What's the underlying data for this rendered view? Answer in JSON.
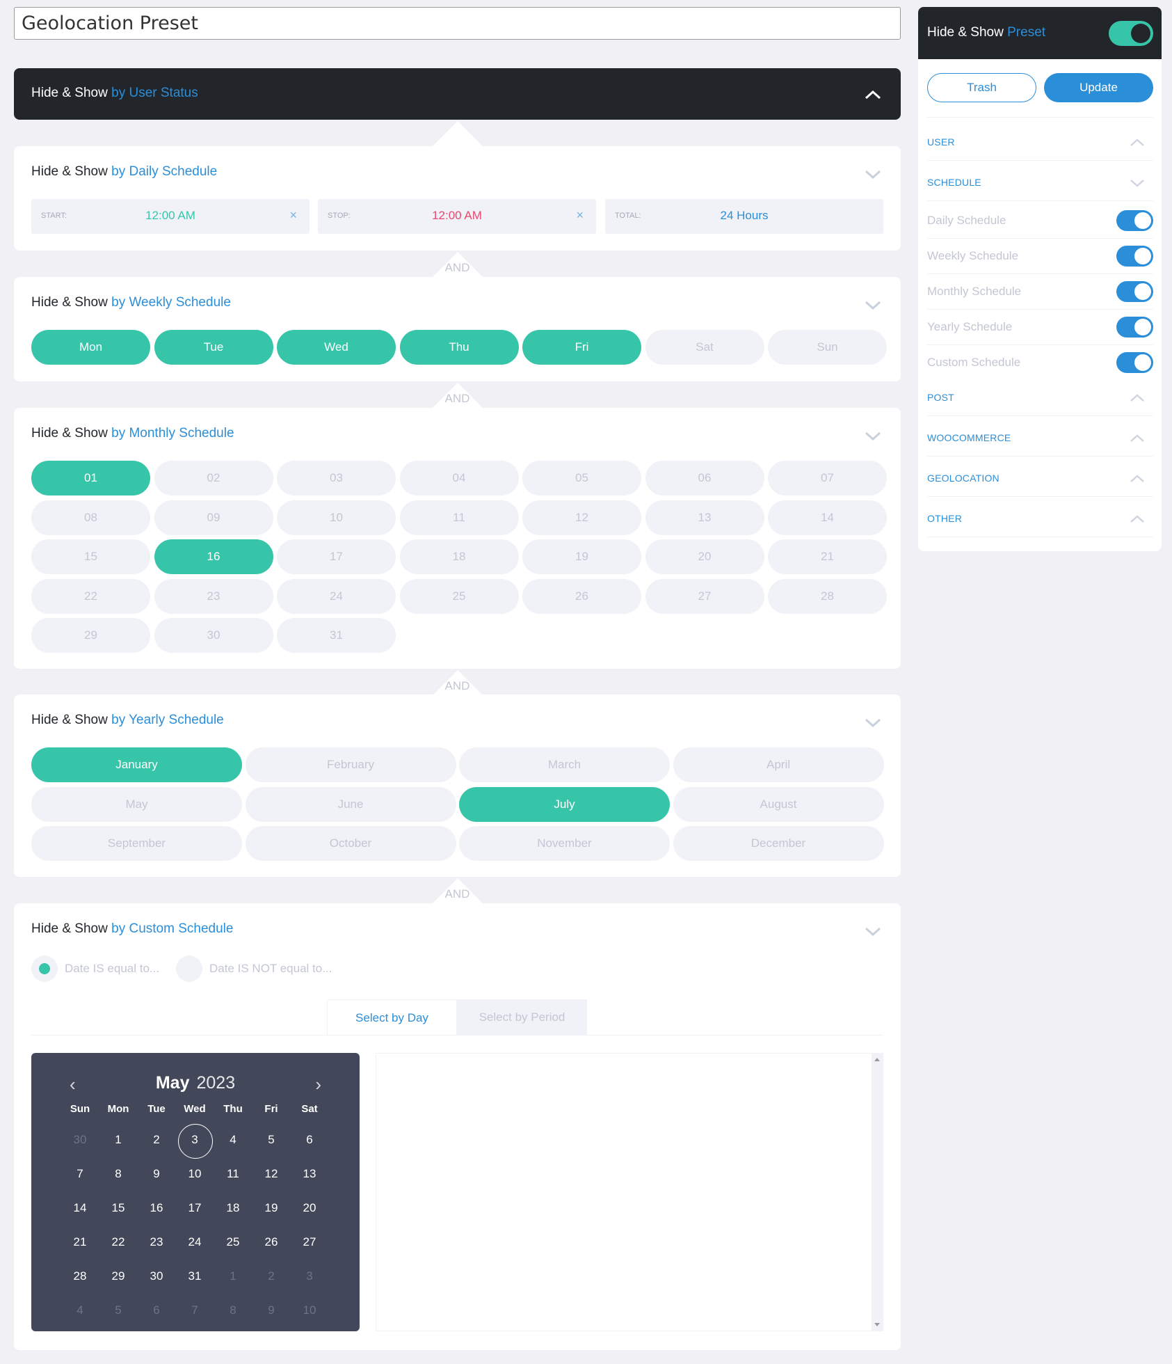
{
  "preset_title": "Geolocation Preset",
  "colors": {
    "accent_blue": "#2b8ed9",
    "accent_green": "#37c5aa",
    "stop_red": "#e8476e",
    "dark": "#22262b",
    "calendar_bg": "#424759"
  },
  "connector_label": "AND",
  "user_status": {
    "prefix": "Hide & Show",
    "accent": "by User Status",
    "icon": "chevron-up-icon"
  },
  "daily": {
    "prefix": "Hide & Show",
    "accent": "by Daily Schedule",
    "start_label": "START:",
    "start_value": "12:00 AM",
    "stop_label": "STOP:",
    "stop_value": "12:00 AM",
    "total_label": "TOTAL:",
    "total_value": "24 Hours",
    "clear_icon": "×"
  },
  "weekly": {
    "prefix": "Hide & Show",
    "accent": "by Weekly Schedule",
    "days": [
      {
        "label": "Mon",
        "selected": true
      },
      {
        "label": "Tue",
        "selected": true
      },
      {
        "label": "Wed",
        "selected": true
      },
      {
        "label": "Thu",
        "selected": true
      },
      {
        "label": "Fri",
        "selected": true
      },
      {
        "label": "Sat",
        "selected": false
      },
      {
        "label": "Sun",
        "selected": false
      }
    ]
  },
  "monthly": {
    "prefix": "Hide & Show",
    "accent": "by Monthly Schedule",
    "days": [
      "01",
      "02",
      "03",
      "04",
      "05",
      "06",
      "07",
      "08",
      "09",
      "10",
      "11",
      "12",
      "13",
      "14",
      "15",
      "16",
      "17",
      "18",
      "19",
      "20",
      "21",
      "22",
      "23",
      "24",
      "25",
      "26",
      "27",
      "28",
      "29",
      "30",
      "31"
    ],
    "selected": [
      "01",
      "16"
    ]
  },
  "yearly": {
    "prefix": "Hide & Show",
    "accent": "by Yearly Schedule",
    "months": [
      "January",
      "February",
      "March",
      "April",
      "May",
      "June",
      "July",
      "August",
      "September",
      "October",
      "November",
      "December"
    ],
    "selected": [
      "January",
      "July"
    ]
  },
  "custom": {
    "prefix": "Hide & Show",
    "accent": "by Custom Schedule",
    "radio_equal": "Date IS equal to...",
    "radio_not_equal": "Date IS NOT equal to...",
    "radio_selected": "equal",
    "tab_day": "Select by Day",
    "tab_period": "Select by Period",
    "active_tab": "day",
    "calendar": {
      "month": "May",
      "year": "2023",
      "prev_icon": "‹",
      "next_icon": "›",
      "weekdays": [
        "Sun",
        "Mon",
        "Tue",
        "Wed",
        "Thu",
        "Fri",
        "Sat"
      ],
      "today": 3,
      "weeks": [
        [
          {
            "d": 30,
            "m": true
          },
          {
            "d": 1
          },
          {
            "d": 2
          },
          {
            "d": 3,
            "today": true
          },
          {
            "d": 4
          },
          {
            "d": 5
          },
          {
            "d": 6
          }
        ],
        [
          {
            "d": 7
          },
          {
            "d": 8
          },
          {
            "d": 9
          },
          {
            "d": 10
          },
          {
            "d": 11
          },
          {
            "d": 12
          },
          {
            "d": 13
          }
        ],
        [
          {
            "d": 14
          },
          {
            "d": 15
          },
          {
            "d": 16
          },
          {
            "d": 17
          },
          {
            "d": 18
          },
          {
            "d": 19
          },
          {
            "d": 20
          }
        ],
        [
          {
            "d": 21
          },
          {
            "d": 22
          },
          {
            "d": 23
          },
          {
            "d": 24
          },
          {
            "d": 25
          },
          {
            "d": 26
          },
          {
            "d": 27
          }
        ],
        [
          {
            "d": 28
          },
          {
            "d": 29
          },
          {
            "d": 30
          },
          {
            "d": 31
          },
          {
            "d": 1,
            "m": true
          },
          {
            "d": 2,
            "m": true
          },
          {
            "d": 3,
            "m": true
          }
        ],
        [
          {
            "d": 4,
            "m": true
          },
          {
            "d": 5,
            "m": true
          },
          {
            "d": 6,
            "m": true
          },
          {
            "d": 7,
            "m": true
          },
          {
            "d": 8,
            "m": true
          },
          {
            "d": 9,
            "m": true
          },
          {
            "d": 10,
            "m": true
          }
        ]
      ]
    },
    "dates_text": ""
  },
  "sidebar": {
    "prefix": "Hide & Show",
    "accent": "Preset",
    "preset_enabled": true,
    "trash_label": "Trash",
    "update_label": "Update",
    "sections": [
      {
        "label": "USER",
        "icon": "chevron-up-icon"
      },
      {
        "label": "SCHEDULE",
        "icon": "chevron-down-icon"
      },
      {
        "label": "POST",
        "icon": "chevron-up-icon"
      },
      {
        "label": "WOOCOMMERCE",
        "icon": "chevron-up-icon"
      },
      {
        "label": "GEOLOCATION",
        "icon": "chevron-up-icon"
      },
      {
        "label": "OTHER",
        "icon": "chevron-up-icon"
      }
    ],
    "schedule_toggles": [
      {
        "label": "Daily Schedule",
        "on": true
      },
      {
        "label": "Weekly Schedule",
        "on": true
      },
      {
        "label": "Monthly Schedule",
        "on": true
      },
      {
        "label": "Yearly Schedule",
        "on": true
      },
      {
        "label": "Custom Schedule",
        "on": true
      }
    ]
  }
}
